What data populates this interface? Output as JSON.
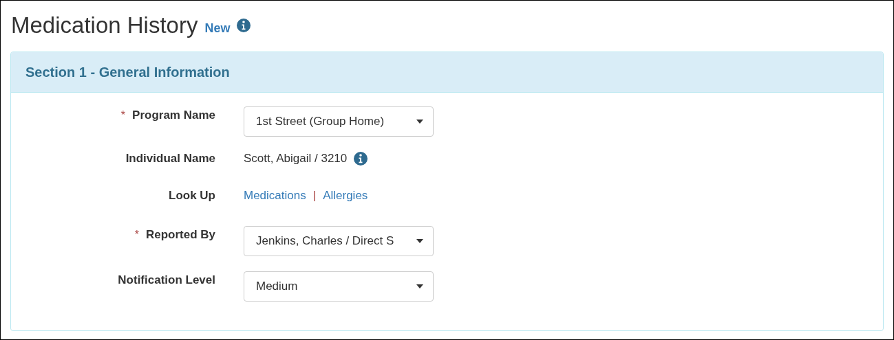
{
  "page": {
    "title": "Medication History",
    "badge": "New"
  },
  "section": {
    "title": "Section 1 - General Information",
    "required_mark": "*",
    "fields": [
      {
        "kind": "select",
        "label": "Program Name",
        "required": true,
        "value": "1st Street (Group Home)"
      },
      {
        "kind": "text",
        "label": "Individual Name",
        "required": false,
        "value": "Scott, Abigail / 3210"
      },
      {
        "kind": "links",
        "label": "Look Up",
        "required": false,
        "links": [
          "Medications",
          "Allergies"
        ],
        "separator": "|"
      },
      {
        "kind": "select",
        "label": "Reported By",
        "required": true,
        "value": "Jenkins, Charles / Direct S"
      },
      {
        "kind": "select",
        "label": "Notification Level",
        "required": false,
        "value": "Medium"
      }
    ]
  }
}
